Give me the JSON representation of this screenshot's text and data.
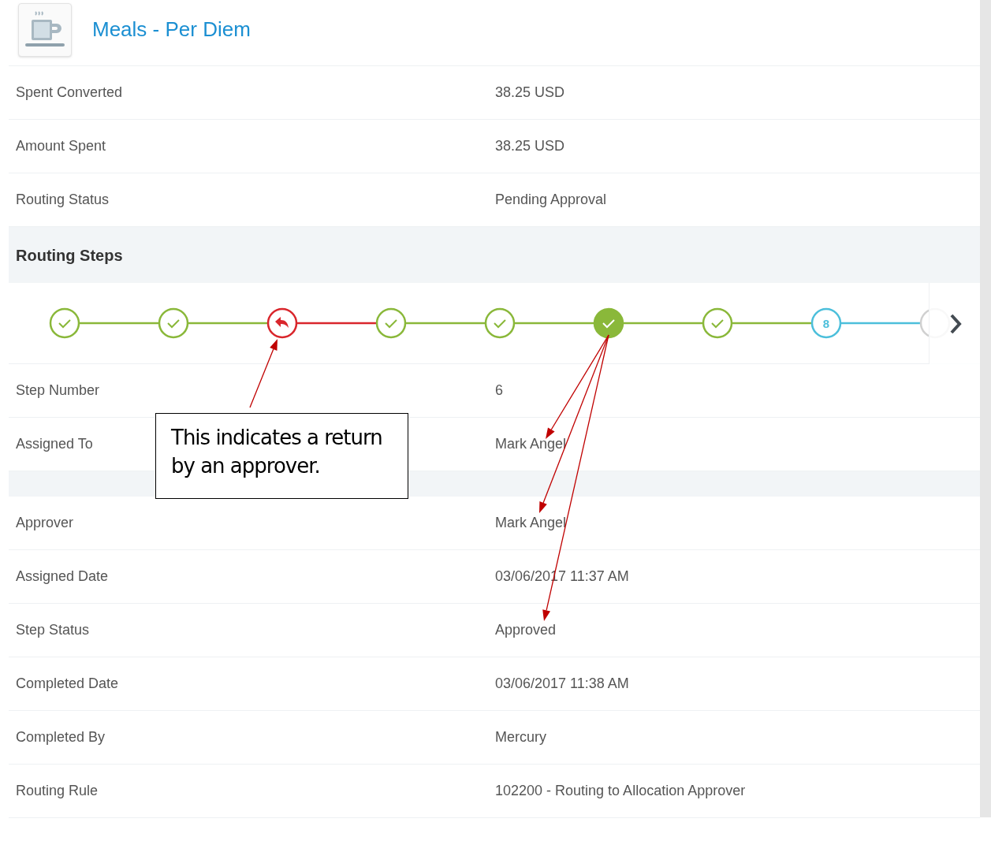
{
  "header": {
    "title": "Meals - Per Diem"
  },
  "summary_fields": [
    {
      "label": "Spent Converted",
      "value": "38.25 USD"
    },
    {
      "label": "Amount Spent",
      "value": "38.25 USD"
    },
    {
      "label": "Routing Status",
      "value": "Pending Approval"
    }
  ],
  "routing_steps": {
    "title": "Routing Steps",
    "steps": [
      {
        "kind": "approved",
        "selected": false
      },
      {
        "kind": "approved",
        "selected": false
      },
      {
        "kind": "returned",
        "selected": false
      },
      {
        "kind": "approved",
        "selected": false
      },
      {
        "kind": "approved",
        "selected": false
      },
      {
        "kind": "approved",
        "selected": true
      },
      {
        "kind": "approved",
        "selected": false
      },
      {
        "kind": "pending",
        "number": "8",
        "selected": false
      },
      {
        "kind": "future",
        "selected": false
      }
    ]
  },
  "step_fields": [
    {
      "label": "Step Number",
      "value": "6"
    },
    {
      "label": "Assigned To",
      "value": "Mark Angel"
    }
  ],
  "detail_fields": [
    {
      "label": "Approver",
      "value": "Mark Angel"
    },
    {
      "label": "Assigned Date",
      "value": "03/06/2017 11:37 AM"
    },
    {
      "label": "Step Status",
      "value": "Approved"
    },
    {
      "label": "Completed Date",
      "value": "03/06/2017 11:38 AM"
    },
    {
      "label": "Completed By",
      "value": "Mercury"
    },
    {
      "label": "Routing Rule",
      "value": "102200 - Routing to Allocation Approver"
    }
  ],
  "callout": {
    "text": "This indicates a return by an approver."
  }
}
